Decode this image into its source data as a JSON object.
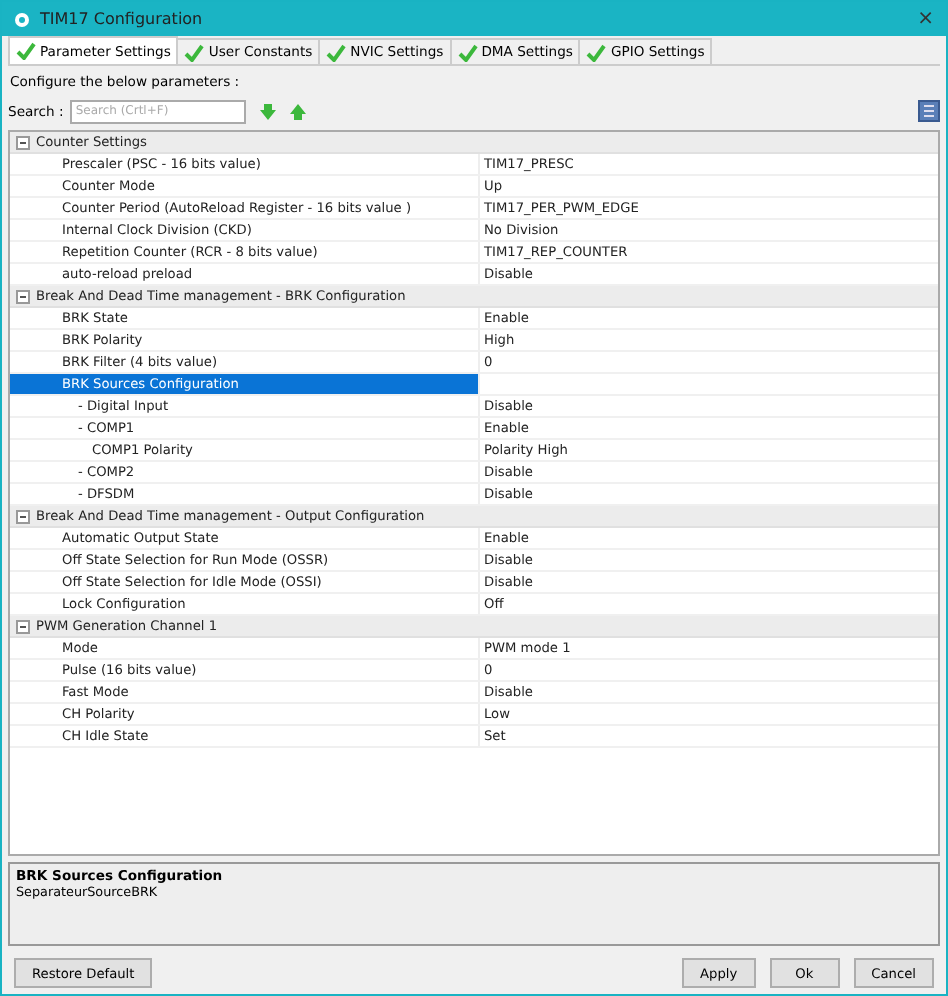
{
  "window": {
    "title": "TIM17 Configuration",
    "close": "×"
  },
  "tabs": [
    {
      "label": "Parameter Settings",
      "selected": true,
      "ok": true
    },
    {
      "label": "User Constants",
      "selected": false,
      "ok": true
    },
    {
      "label": "NVIC Settings",
      "selected": false,
      "ok": true
    },
    {
      "label": "DMA Settings",
      "selected": false,
      "ok": true
    },
    {
      "label": "GPIO Settings",
      "selected": false,
      "ok": true
    }
  ],
  "intro": "Configure the below parameters :",
  "search": {
    "label": "Search :",
    "placeholder": "Search (Crtl+F)"
  },
  "groups": [
    {
      "title": "Counter Settings",
      "expanded": true,
      "rows": [
        {
          "name": "Prescaler (PSC - 16 bits value)",
          "value": "TIM17_PRESC",
          "selected": false
        },
        {
          "name": "Counter Mode",
          "value": "Up",
          "selected": false
        },
        {
          "name": "Counter Period (AutoReload Register - 16 bits value )",
          "value": "TIM17_PER_PWM_EDGE",
          "selected": false
        },
        {
          "name": "Internal Clock Division (CKD)",
          "value": "No Division",
          "selected": false
        },
        {
          "name": "Repetition Counter (RCR - 8 bits value)",
          "value": "TIM17_REP_COUNTER",
          "selected": false
        },
        {
          "name": "auto-reload preload",
          "value": "Disable",
          "selected": false
        }
      ]
    },
    {
      "title": "Break And Dead Time management - BRK Configuration",
      "expanded": true,
      "rows": [
        {
          "name": "BRK State",
          "value": "Enable",
          "selected": false
        },
        {
          "name": "BRK Polarity",
          "value": "High",
          "selected": false
        },
        {
          "name": "BRK Filter (4 bits value)",
          "value": "0",
          "selected": false
        },
        {
          "name": "BRK Sources Configuration",
          "selected": true,
          "children": [
            {
              "name": "- Digital Input",
              "value": "Disable",
              "selected": false
            },
            {
              "name": "- COMP1",
              "value": "Enable",
              "selected": false,
              "children": [
                {
                  "name": "COMP1 Polarity",
                  "value": "Polarity High",
                  "selected": false
                }
              ]
            },
            {
              "name": "- COMP2",
              "value": "Disable",
              "selected": false
            },
            {
              "name": "- DFSDM",
              "value": "Disable",
              "selected": false
            }
          ]
        }
      ]
    },
    {
      "title": "Break And Dead Time management - Output Configuration",
      "expanded": true,
      "rows": [
        {
          "name": "Automatic Output State",
          "value": "Enable",
          "selected": false
        },
        {
          "name": "Off State Selection for Run Mode (OSSR)",
          "value": "Disable",
          "selected": false
        },
        {
          "name": "Off State Selection for Idle Mode (OSSI)",
          "value": "Disable",
          "selected": false
        },
        {
          "name": "Lock Configuration",
          "value": "Off",
          "selected": false
        }
      ]
    },
    {
      "title": "PWM Generation Channel 1",
      "expanded": true,
      "rows": [
        {
          "name": "Mode",
          "value": "PWM mode 1",
          "selected": false
        },
        {
          "name": "Pulse (16 bits value)",
          "value": "0",
          "selected": false
        },
        {
          "name": "Fast Mode",
          "value": "Disable",
          "selected": false
        },
        {
          "name": "CH Polarity",
          "value": "Low",
          "selected": false
        },
        {
          "name": "CH Idle State",
          "value": "Set",
          "selected": false
        }
      ]
    }
  ],
  "info": {
    "title": "BRK Sources Configuration",
    "text": "SeparateurSourceBRK"
  },
  "buttons": {
    "left": [
      "Restore Default"
    ],
    "right": [
      "Apply",
      "Ok",
      "Cancel"
    ]
  }
}
